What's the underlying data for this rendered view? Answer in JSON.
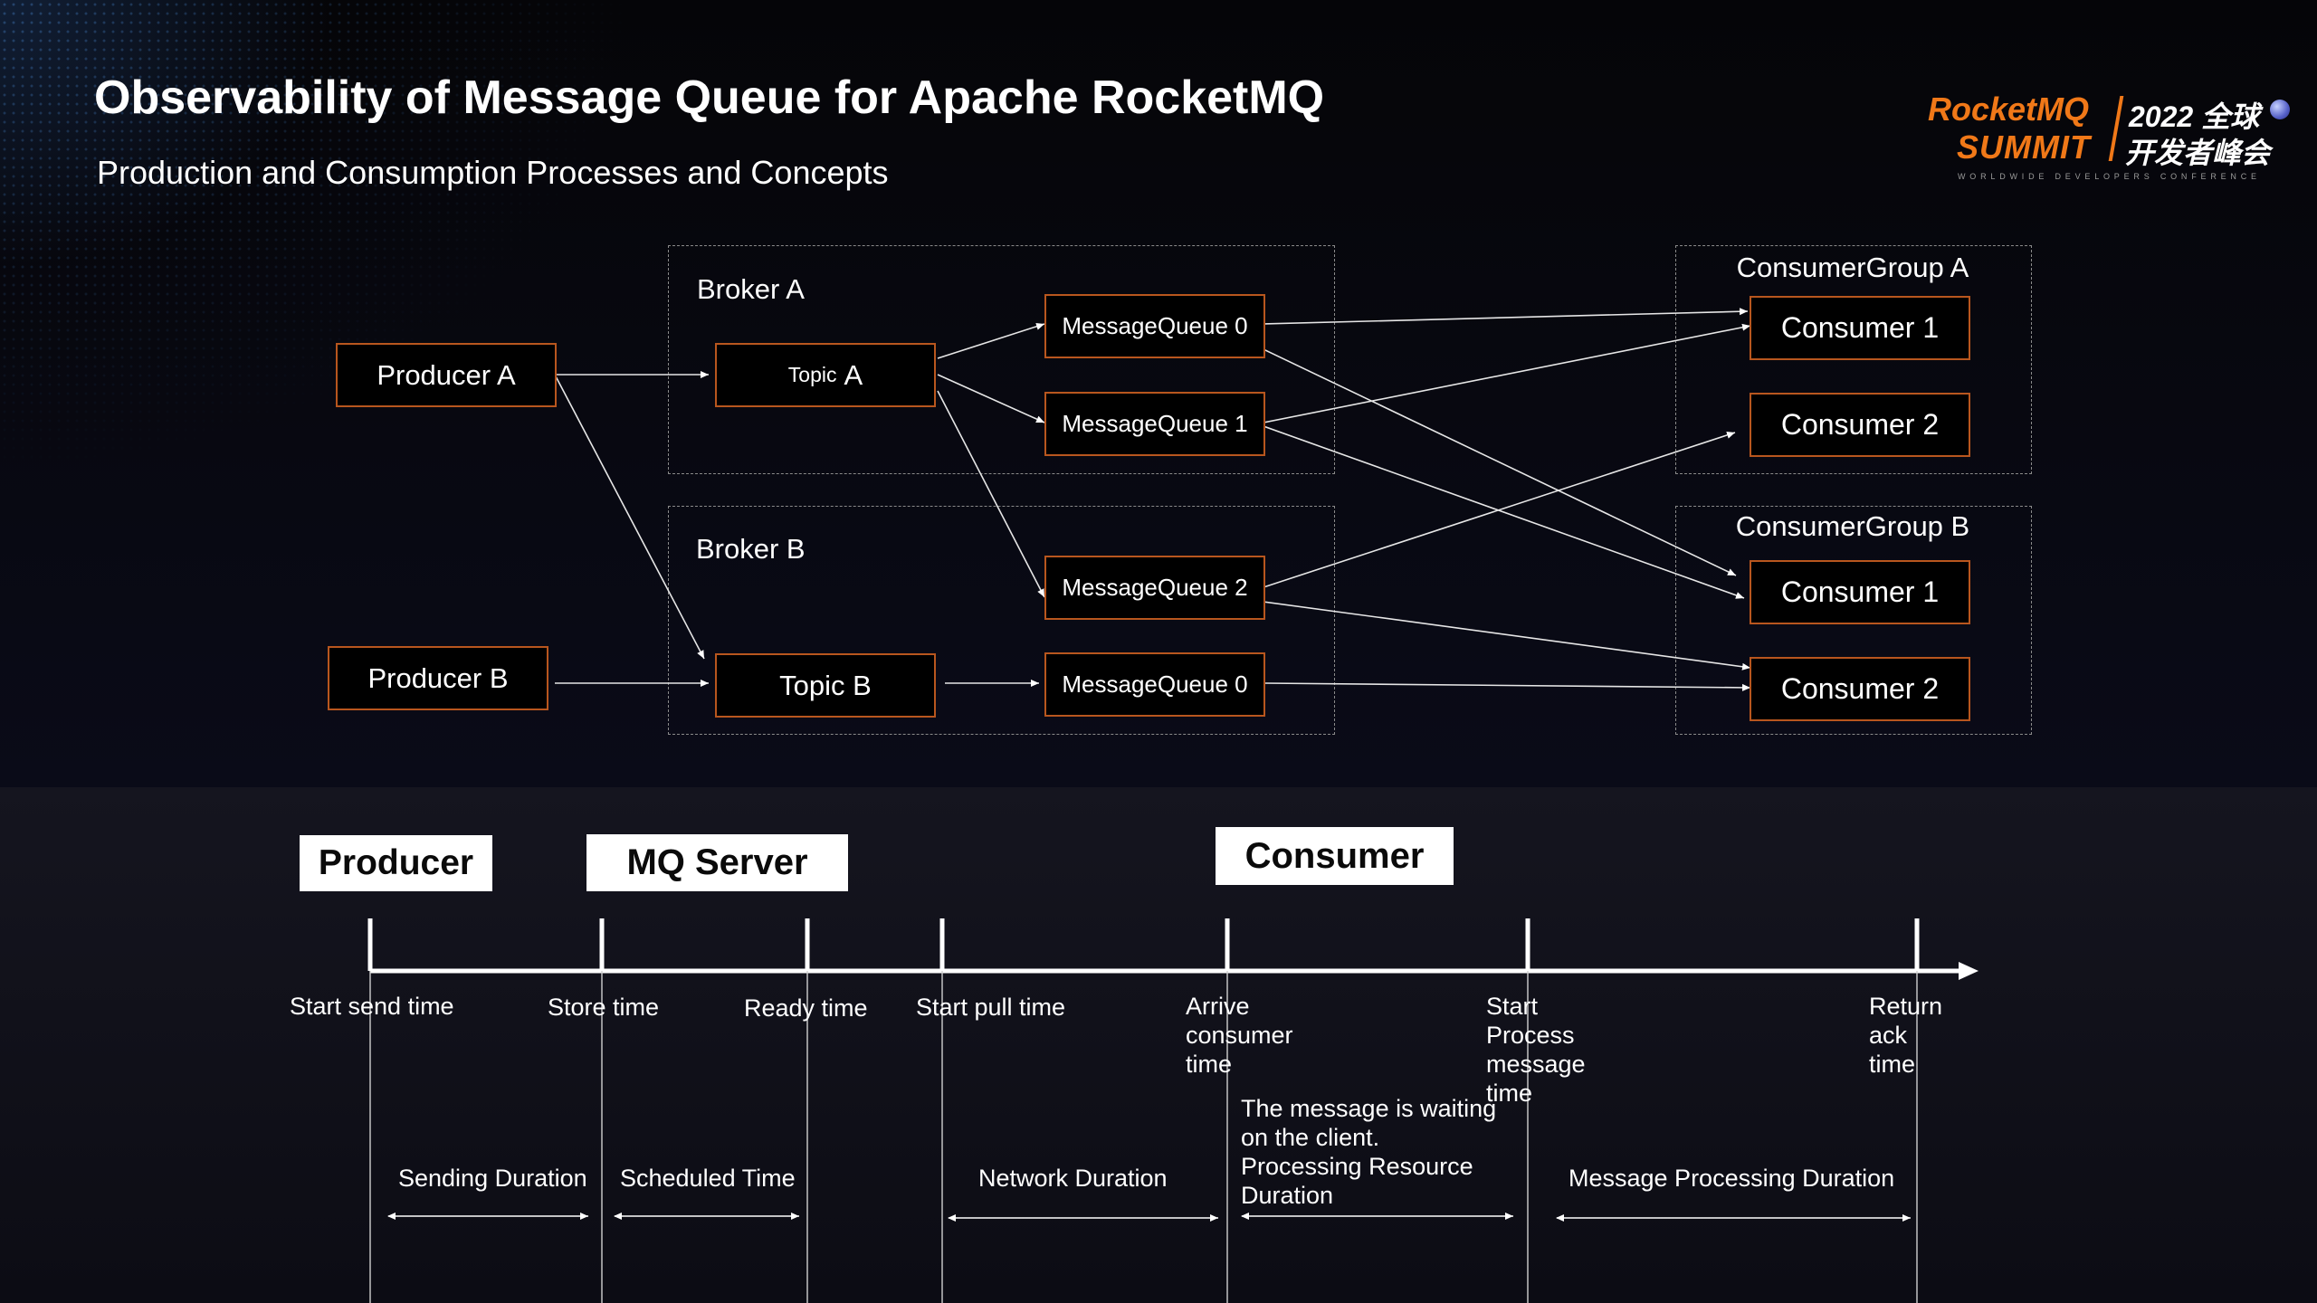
{
  "title": "Observability of Message Queue for Apache RocketMQ",
  "subtitle": "Production and Consumption Processes and Concepts",
  "logo": {
    "brand": "RocketMQ",
    "summit": "SUMMIT",
    "year": "2022 全球",
    "line2": "开发者峰会",
    "tagline": "WORLDWIDE DEVELOPERS CONFERENCE",
    "brand_color": "#f07818"
  },
  "diagram": {
    "producers": {
      "a": "Producer A",
      "b": "Producer B"
    },
    "broker_a": {
      "label": "Broker A",
      "topic_prefix": "Topic",
      "topic_letter": "A",
      "queues": [
        "MessageQueue 0",
        "MessageQueue 1"
      ]
    },
    "broker_b": {
      "label": "Broker B",
      "topic": "Topic B",
      "queues": [
        "MessageQueue 2",
        "MessageQueue 0"
      ]
    },
    "group_a": {
      "label": "ConsumerGroup A",
      "consumers": [
        "Consumer 1",
        "Consumer 2"
      ]
    },
    "group_b": {
      "label": "ConsumerGroup B",
      "consumers": [
        "Consumer 1",
        "Consumer 2"
      ]
    },
    "border_color": "#b8561e"
  },
  "timeline": {
    "headers": {
      "producer": "Producer",
      "server": "MQ Server",
      "consumer": "Consumer"
    },
    "points": {
      "start_send": "Start send time",
      "store": "Store time",
      "ready": "Ready time",
      "start_pull": "Start pull time",
      "arrive": [
        "Arrive",
        "consumer",
        "time"
      ],
      "start_process": [
        "Start",
        "Process",
        "message",
        "time"
      ],
      "return_ack": [
        "Return",
        "ack",
        "time"
      ]
    },
    "durations": {
      "sending": "Sending Duration",
      "scheduled": "Scheduled Time",
      "network": "Network Duration",
      "waiting": [
        "The message is waiting",
        "on the client.",
        "Processing Resource",
        "Duration"
      ],
      "processing": "Message Processing Duration"
    }
  }
}
